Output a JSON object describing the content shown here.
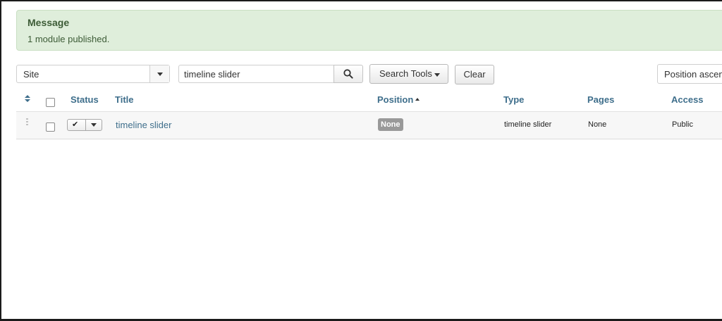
{
  "message": {
    "heading": "Message",
    "text": "1 module published."
  },
  "filters": {
    "client_value": "Site",
    "search_value": "timeline slider",
    "search_tools_label": "Search Tools",
    "clear_label": "Clear",
    "ordering_value": "Position ascending"
  },
  "table": {
    "headers": {
      "status": "Status",
      "title": "Title",
      "position": "Position",
      "type": "Type",
      "pages": "Pages",
      "access": "Access"
    },
    "rows": [
      {
        "title": "timeline slider",
        "position": "None",
        "type": "timeline slider",
        "pages": "None",
        "access": "Public",
        "published": true
      }
    ]
  },
  "icons": {
    "ordering": "sort-icon",
    "search": "search-icon",
    "status": "check-icon",
    "drag": "drag-handle-icon"
  },
  "colors": {
    "message_bg": "#dfeedb",
    "link": "#3e6e8b",
    "badge": "#999999"
  }
}
